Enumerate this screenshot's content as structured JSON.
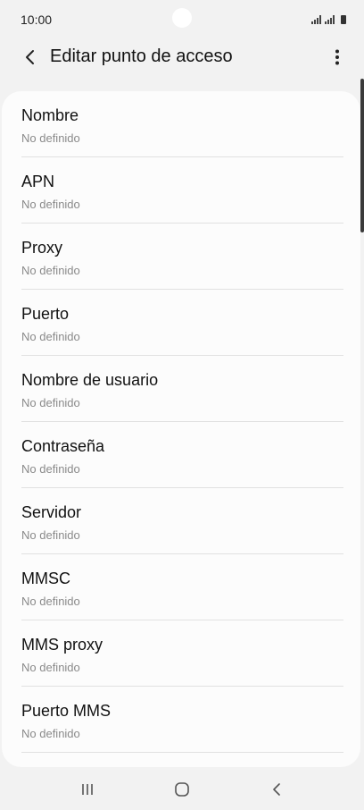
{
  "status_bar": {
    "time": "10:00"
  },
  "header": {
    "title": "Editar punto de acceso"
  },
  "items": [
    {
      "title": "Nombre",
      "subtitle": "No definido"
    },
    {
      "title": "APN",
      "subtitle": "No definido"
    },
    {
      "title": "Proxy",
      "subtitle": "No definido"
    },
    {
      "title": "Puerto",
      "subtitle": "No definido"
    },
    {
      "title": "Nombre de usuario",
      "subtitle": "No definido"
    },
    {
      "title": "Contraseña",
      "subtitle": "No definido"
    },
    {
      "title": "Servidor",
      "subtitle": "No definido"
    },
    {
      "title": "MMSC",
      "subtitle": "No definido"
    },
    {
      "title": "MMS proxy",
      "subtitle": "No definido"
    },
    {
      "title": "Puerto MMS",
      "subtitle": "No definido"
    }
  ],
  "icons": {
    "back": "chevron-left-icon",
    "more": "more-vertical-icon",
    "nav_recent": "recent-apps-icon",
    "nav_home": "home-icon",
    "nav_back": "back-icon"
  },
  "colors": {
    "background": "#f2f2f2",
    "card": "#fcfcfc",
    "subtitle": "#8a8a8a",
    "divider": "#e1e1e1"
  }
}
